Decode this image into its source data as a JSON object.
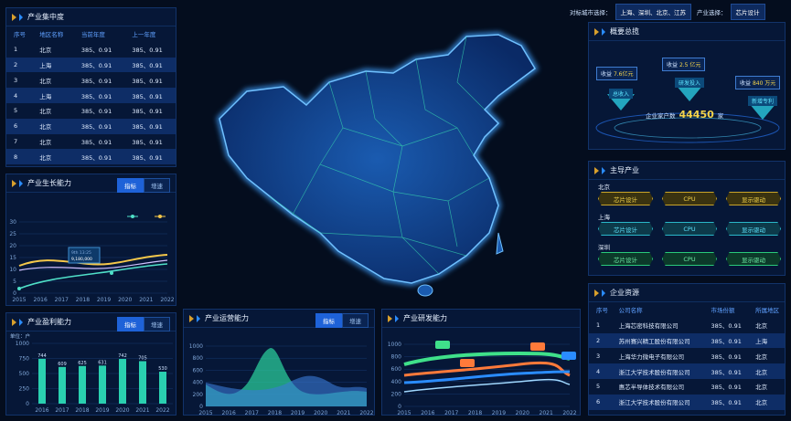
{
  "topbar": {
    "city_label": "对标城市选择：",
    "city_value": "上海、深圳、北京、江苏",
    "industry_label": "产业选择：",
    "industry_value": "芯片设计"
  },
  "concentration": {
    "title": "产业集中度",
    "headers": [
      "序号",
      "地区名称",
      "当前年度",
      "上一年度"
    ],
    "rows": [
      [
        "1",
        "北京",
        "385、0.91",
        "385、0.91"
      ],
      [
        "2",
        "上海",
        "385、0.91",
        "385、0.91"
      ],
      [
        "3",
        "北京",
        "385、0.91",
        "385、0.91"
      ],
      [
        "4",
        "上海",
        "385、0.91",
        "385、0.91"
      ],
      [
        "5",
        "北京",
        "385、0.91",
        "385、0.91"
      ],
      [
        "6",
        "北京",
        "385、0.91",
        "385、0.91"
      ],
      [
        "7",
        "北京",
        "385、0.91",
        "385、0.91"
      ],
      [
        "8",
        "北京",
        "385、0.91",
        "385、0.91"
      ]
    ]
  },
  "growth": {
    "title": "产业生长能力",
    "tab1": "指标",
    "tab2": "增速",
    "tooltip_date": "9th 13:25",
    "tooltip_value": "9,180,000",
    "yticks": [
      "30",
      "25",
      "20",
      "15",
      "10",
      "5",
      "0"
    ],
    "years": [
      "2015",
      "2016",
      "2017",
      "2018",
      "2019",
      "2020",
      "2021",
      "2022"
    ]
  },
  "profit": {
    "title": "产业盈利能力",
    "tab1": "指标",
    "tab2": "增速",
    "unit": "单位：户",
    "yticks": [
      "1000",
      "750",
      "500",
      "250",
      "0"
    ],
    "chart_data": {
      "type": "bar",
      "categories": [
        "2016",
        "2017",
        "2018",
        "2019",
        "2020",
        "2021",
        "2022"
      ],
      "values": [
        744,
        609,
        625,
        631,
        742,
        705,
        530
      ],
      "ylim": [
        0,
        1000
      ]
    }
  },
  "operation": {
    "title": "产业运营能力",
    "tab1": "指标",
    "tab2": "增速",
    "yticks": [
      "1000",
      "800",
      "600",
      "400",
      "200",
      "0"
    ],
    "years": [
      "2015",
      "2016",
      "2017",
      "2018",
      "2019",
      "2020",
      "2021",
      "2022"
    ]
  },
  "rd": {
    "title": "产业研发能力",
    "yticks": [
      "1000",
      "800",
      "600",
      "400",
      "200",
      "0"
    ],
    "years": [
      "2015",
      "2016",
      "2017",
      "2018",
      "2019",
      "2020",
      "2021",
      "2022"
    ]
  },
  "overview": {
    "title": "概要总揽",
    "income_label": "收益",
    "item1_value": "7.6亿元",
    "item1_name": "总收入",
    "item2_value": "2.5 亿元",
    "item2_name": "研发投入",
    "item3_value": "840 万元",
    "item3_name": "新增专利",
    "households_label": "企业家户数",
    "households_value": "44450",
    "households_unit": "家"
  },
  "leading": {
    "title": "主导产业",
    "regions": [
      {
        "name": "北京",
        "items": [
          "芯片设计",
          "CPU",
          "显示驱动"
        ]
      },
      {
        "name": "上海",
        "items": [
          "芯片设计",
          "CPU",
          "显示驱动"
        ]
      },
      {
        "name": "深圳",
        "items": [
          "芯片设计",
          "CPU",
          "显示驱动"
        ]
      }
    ]
  },
  "companies": {
    "title": "企业资源",
    "headers": [
      "序号",
      "公司名称",
      "市场份额",
      "所属地区"
    ],
    "rows": [
      [
        "1",
        "上海芯密科技有限公司",
        "385、0.91",
        "北京"
      ],
      [
        "2",
        "苏州赛兴精工股份有限公司",
        "385、0.91",
        "上海"
      ],
      [
        "3",
        "上海华力微电子有限公司",
        "385、0.91",
        "北京"
      ],
      [
        "4",
        "浙江大学技术股份有限公司",
        "385、0.91",
        "北京"
      ],
      [
        "5",
        "惠芯半导体技术有限公司",
        "385、0.91",
        "北京"
      ],
      [
        "6",
        "浙江大学技术股份有限公司",
        "385、0.91",
        "北京"
      ]
    ]
  }
}
